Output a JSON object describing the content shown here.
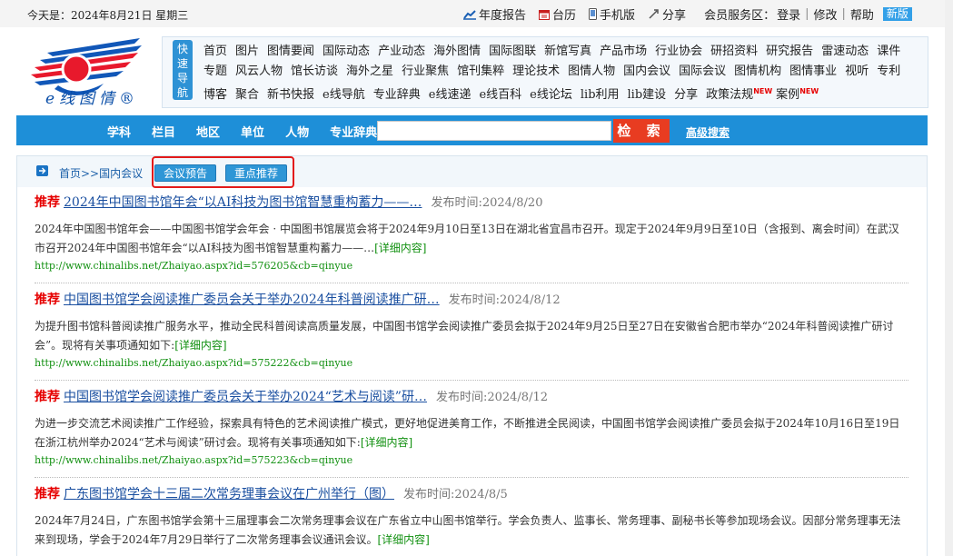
{
  "topbar": {
    "date": "今天是：2024年8月21日  星期三",
    "links": [
      {
        "label": "年度报告",
        "icon": "chart-icon"
      },
      {
        "label": "台历",
        "icon": "calendar-icon"
      },
      {
        "label": "手机版",
        "icon": "mobile-icon"
      },
      {
        "label": "分享",
        "icon": "share-icon"
      }
    ],
    "member_label": "会员服务区：",
    "login": "登录",
    "modify": "修改",
    "help": "帮助",
    "new_badge": "新版"
  },
  "logo": {
    "text": "e线图情®"
  },
  "quick_nav": {
    "label": "快速导航",
    "items": [
      "首页",
      "图片",
      "图情要闻",
      "国际动态",
      "产业动态",
      "海外图情",
      "国际图联",
      "新馆写真",
      "产品市场",
      "行业协会",
      "研招资料",
      "研究报告",
      "雷速动态",
      "课件",
      "专题",
      "风云人物",
      "馆长访谈",
      "海外之星",
      "行业聚焦",
      "馆刊集粹",
      "理论技术",
      "图情人物",
      "国内会议",
      "国际会议",
      "图情机构",
      "图情事业",
      "视听",
      "专利",
      "博客",
      "聚合",
      "新书快报",
      "e线导航",
      "专业辞典",
      "e线速递",
      "e线百科",
      "e线论坛",
      "lib利用",
      "lib建设",
      "分享",
      "政策法规",
      "案例"
    ],
    "new_items": [
      "政策法规",
      "案例"
    ],
    "new_label": "NEW"
  },
  "search": {
    "categories": [
      "学科",
      "栏目",
      "地区",
      "单位",
      "人物",
      "专业辞典"
    ],
    "input_value": "",
    "button_label": "检 索",
    "advanced_label": "高级搜索"
  },
  "breadcrumb": {
    "text": "首页>>国内会议",
    "tabs": [
      "会议预告",
      "重点推荐"
    ]
  },
  "articles": [
    {
      "tag": "推荐",
      "title": "2024年中国图书馆年会“以AI科技为图书馆智慧重构蓄力——…",
      "date": "发布时间:2024/8/20",
      "body": "2024年中国图书馆年会——中国图书馆学会年会 · 中国图书馆展览会将于2024年9月10日至13日在湖北省宜昌市召开。现定于2024年9月9日至10日（含报到、离会时间）在武汉市召开2024年中国图书馆年会“以AI科技为图书馆智慧重构蓄力——…",
      "more": "[详细内容]",
      "url": "http://www.chinalibs.net/Zhaiyao.aspx?id=576205&cb=qinyue"
    },
    {
      "tag": "推荐",
      "title": "中国图书馆学会阅读推广委员会关于举办2024年科普阅读推广研…",
      "date": "发布时间:2024/8/12",
      "body": "为提升图书馆科普阅读推广服务水平，推动全民科普阅读高质量发展，中国图书馆学会阅读推广委员会拟于2024年9月25日至27日在安徽省合肥市举办“2024年科普阅读推广研讨会”。现将有关事项通知如下:",
      "more": "[详细内容]",
      "url": "http://www.chinalibs.net/Zhaiyao.aspx?id=575222&cb=qinyue"
    },
    {
      "tag": "推荐",
      "title": "中国图书馆学会阅读推广委员会关于举办2024“艺术与阅读”研…",
      "date": "发布时间:2024/8/12",
      "body": "为进一步交流艺术阅读推广工作经验，探索具有特色的艺术阅读推广模式，更好地促进美育工作，不断推进全民阅读，中国图书馆学会阅读推广委员会拟于2024年10月16日至19日在浙江杭州举办2024“艺术与阅读”研讨会。现将有关事项通知如下:",
      "more": "[详细内容]",
      "url": "http://www.chinalibs.net/Zhaiyao.aspx?id=575223&cb=qinyue"
    },
    {
      "tag": "推荐",
      "title": "广东图书馆学会十三届二次常务理事会议在广州举行（图）",
      "date": "发布时间:2024/8/5",
      "body": "2024年7月24日，广东图书馆学会第十三届理事会二次常务理事会议在广东省立中山图书馆举行。学会负责人、监事长、常务理事、副秘书长等参加现场会议。因部分常务理事无法来到现场，学会于2024年7月29日举行了二次常务理事会议通讯会议。",
      "more": "[详细内容]",
      "url": ""
    }
  ],
  "colors": {
    "brand_blue": "#1e8fd8",
    "search_red": "#e83c21",
    "tag_red": "#e60000",
    "link_green": "#119010"
  }
}
